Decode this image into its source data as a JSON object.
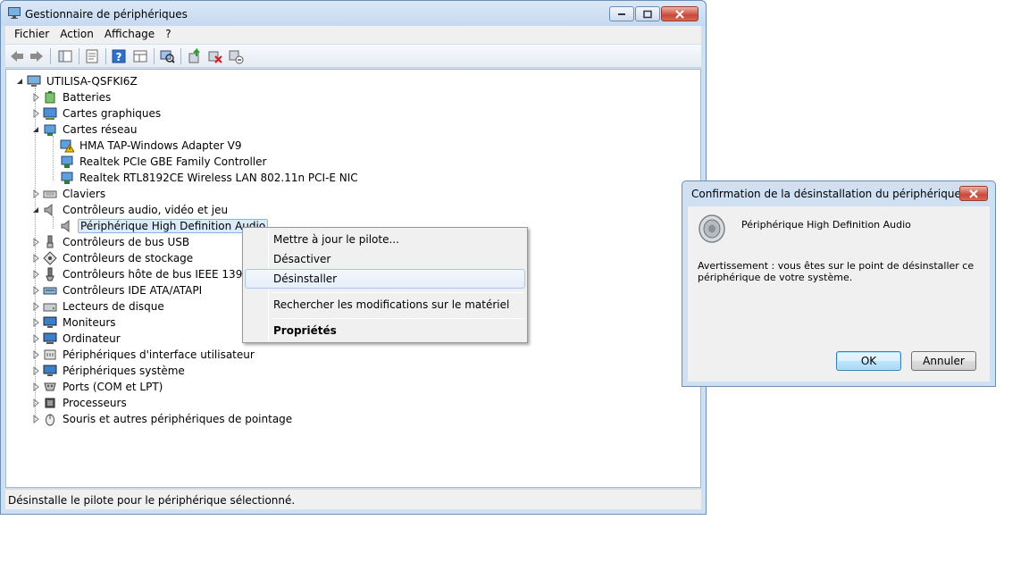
{
  "window": {
    "title": "Gestionnaire de périphériques"
  },
  "menubar": [
    "Fichier",
    "Action",
    "Affichage",
    "?"
  ],
  "toolbar_icons": [
    "back-arrow-icon",
    "forward-arrow-icon",
    "show-hide-tree-icon",
    "properties-icon",
    "help-icon",
    "view-icon",
    "scan-hardware-icon",
    "update-driver-icon",
    "uninstall-icon",
    "disable-icon"
  ],
  "tree": {
    "root": "UTILISA-QSFKI6Z",
    "items": [
      {
        "label": "Batteries",
        "level": 1,
        "expanded": false,
        "icon": "battery-icon"
      },
      {
        "label": "Cartes graphiques",
        "level": 1,
        "expanded": false,
        "icon": "display-adapter-icon"
      },
      {
        "label": "Cartes réseau",
        "level": 1,
        "expanded": true,
        "icon": "network-adapter-icon"
      },
      {
        "label": "HMA TAP-Windows Adapter V9",
        "level": 2,
        "icon": "network-warning-icon"
      },
      {
        "label": "Realtek PCIe GBE Family Controller",
        "level": 2,
        "icon": "network-adapter-icon"
      },
      {
        "label": "Realtek RTL8192CE Wireless LAN 802.11n PCI-E NIC",
        "level": 2,
        "icon": "network-adapter-icon"
      },
      {
        "label": "Claviers",
        "level": 1,
        "expanded": false,
        "icon": "keyboard-icon"
      },
      {
        "label": "Contrôleurs audio, vidéo et jeu",
        "level": 1,
        "expanded": true,
        "icon": "speaker-icon"
      },
      {
        "label": "Périphérique High Definition Audio",
        "level": 2,
        "selected": true,
        "icon": "speaker-icon"
      },
      {
        "label": "Contrôleurs de bus USB",
        "level": 1,
        "expanded": false,
        "icon": "usb-icon"
      },
      {
        "label": "Contrôleurs de stockage",
        "level": 1,
        "expanded": false,
        "icon": "storage-icon"
      },
      {
        "label": "Contrôleurs hôte de bus IEEE 1394",
        "level": 1,
        "expanded": false,
        "icon": "ieee1394-icon"
      },
      {
        "label": "Contrôleurs IDE ATA/ATAPI",
        "level": 1,
        "expanded": false,
        "icon": "ide-icon"
      },
      {
        "label": "Lecteurs de disque",
        "level": 1,
        "expanded": false,
        "icon": "disk-icon"
      },
      {
        "label": "Moniteurs",
        "level": 1,
        "expanded": false,
        "icon": "monitor-icon"
      },
      {
        "label": "Ordinateur",
        "level": 1,
        "expanded": false,
        "icon": "computer-icon"
      },
      {
        "label": "Périphériques d'interface utilisateur",
        "level": 1,
        "expanded": false,
        "icon": "hid-icon"
      },
      {
        "label": "Périphériques système",
        "level": 1,
        "expanded": false,
        "icon": "system-device-icon"
      },
      {
        "label": "Ports (COM et LPT)",
        "level": 1,
        "expanded": false,
        "icon": "port-icon"
      },
      {
        "label": "Processeurs",
        "level": 1,
        "expanded": false,
        "icon": "processor-icon"
      },
      {
        "label": "Souris et autres périphériques de pointage",
        "level": 1,
        "expanded": false,
        "icon": "mouse-icon"
      }
    ]
  },
  "context_menu": {
    "items": [
      {
        "label": "Mettre à jour le pilote..."
      },
      {
        "label": "Désactiver"
      },
      {
        "label": "Désinstaller",
        "hover": true
      },
      {
        "label": "Rechercher les modifications sur le matériel"
      },
      {
        "label": "Propriétés",
        "bold": true
      }
    ]
  },
  "status": "Désinstalle le pilote pour le périphérique sélectionné.",
  "dialog": {
    "title": "Confirmation de la désinstallation du périphérique",
    "device_name": "Périphérique High Definition Audio",
    "warning": "Avertissement : vous êtes sur le point de désinstaller ce périphérique de votre système.",
    "ok_label": "OK",
    "cancel_label": "Annuler"
  },
  "colors": {
    "window_frame": "#cfe0f3",
    "selection_bg": "#dcebfc",
    "selection_border": "#8db2e3",
    "close_button": "#c8493a"
  }
}
